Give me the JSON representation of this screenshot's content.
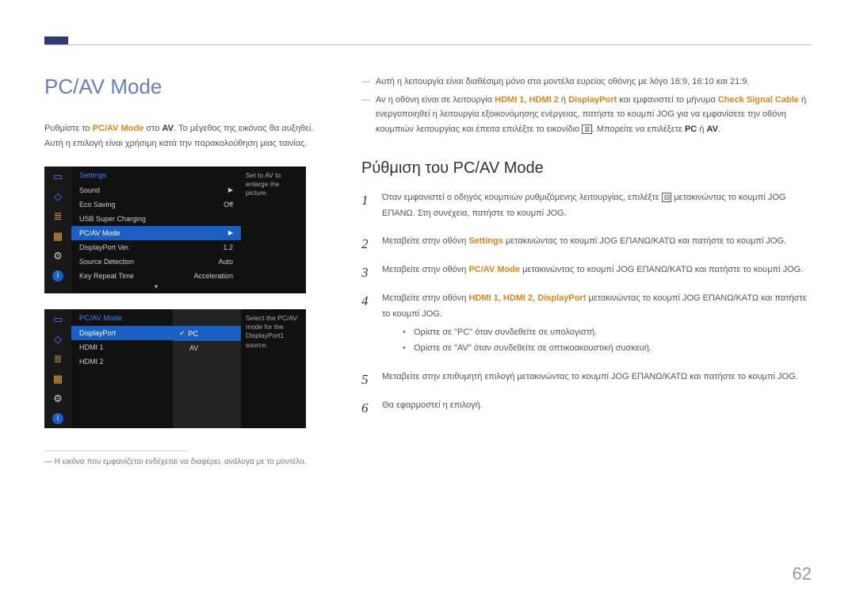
{
  "page_number": "62",
  "title": "PC/AV Mode",
  "intro_line1_pre": "Ρυθμίστε το ",
  "intro_line1_hl": "PC/AV Mode",
  "intro_line1_mid": " στο ",
  "intro_line1_hl2": "AV",
  "intro_line1_post": ". Το μέγεθος της εικόνας θα αυξηθεί.",
  "intro_line2": "Αυτή η επιλογή είναι χρήσιμη κατά την παρακολούθηση μιας ταινίας.",
  "osd1": {
    "header": "Settings",
    "hint": "Set to AV to enlarge the picture.",
    "rows": [
      {
        "label": "Sound",
        "value": "",
        "arrow": true
      },
      {
        "label": "Eco Saving",
        "value": "Off"
      },
      {
        "label": "USB Super Charging",
        "value": ""
      },
      {
        "label": "PC/AV Mode",
        "value": "",
        "arrow": true,
        "selected": true
      },
      {
        "label": "DisplayPort Ver.",
        "value": "1.2"
      },
      {
        "label": "Source Detection",
        "value": "Auto"
      },
      {
        "label": "Key Repeat Time",
        "value": "Acceleration"
      }
    ]
  },
  "osd2": {
    "header": "PC/AV Mode",
    "hint": "Select the PC/AV mode for the DisplayPort1 source.",
    "rows": [
      {
        "label": "DisplayPort",
        "selected": true
      },
      {
        "label": "HDMI 1"
      },
      {
        "label": "HDMI 2"
      }
    ],
    "options": [
      {
        "label": "PC",
        "selected": true,
        "checked": true
      },
      {
        "label": "AV"
      }
    ]
  },
  "footnote": "Η εικόνα που εμφανίζεται ενδέχεται να διαφέρει, ανάλογα με το μοντέλο.",
  "notes": {
    "n1": "Αυτή η λειτουργία είναι διαθέσιμη μόνο στα μοντέλα ευρείας οθόνης με λόγο 16:9, 16:10 και 21:9.",
    "n2_pre": "Αν η οθόνη είναι σε λειτουργία ",
    "n2_h1": "HDMI 1",
    "n2_sep1": ", ",
    "n2_h2": "HDMI 2",
    "n2_or": " ή ",
    "n2_dp": "DisplayPort",
    "n2_mid": " και εμφανιστεί το μήνυμα ",
    "n2_msg": "Check Signal Cable",
    "n2_post": " ή ενεργοποιηθεί η λειτουργία εξοικονόμησης ενέργειας, πατήστε το κουμπί JOG για να εμφανίσετε την οθόνη κουμπιών λειτουργίας και έπειτα επιλέξτε το εικονίδιο ",
    "n2_tail_pre": ". Μπορείτε να επιλέξετε ",
    "n2_pc": "PC",
    "n2_or2": " ή ",
    "n2_av": "AV",
    "n2_end": "."
  },
  "section_title": "Ρύθμιση του PC/AV Mode",
  "steps": {
    "s1a": "Όταν εμφανιστεί ο οδηγός κουμπιών ρυθμιζόμενης λειτουργίας, επιλέξτε ",
    "s1b": " μετακινώντας το κουμπί JOG ΕΠΑΝΩ. Στη συνέχεια, πατήστε το κουμπί JOG.",
    "s2a": "Μεταβείτε στην οθόνη ",
    "s2_hl": "Settings",
    "s2b": " μετακινώντας το κουμπί JOG ΕΠΑΝΩ/ΚΑΤΩ και πατήστε το κουμπί JOG.",
    "s3a": "Μεταβείτε στην οθόνη ",
    "s3_hl": "PC/AV Mode",
    "s3b": " μετακινώντας το κουμπί JOG ΕΠΑΝΩ/ΚΑΤΩ και πατήστε το κουμπί JOG.",
    "s4a": "Μεταβείτε στην οθόνη ",
    "s4_h1": "HDMI 1",
    "s4_sep": ", ",
    "s4_h2": "HDMI 2",
    "s4_sep2": ", ",
    "s4_dp": "DisplayPort",
    "s4b": " μετακινώντας το κουμπί JOG ΕΠΑΝΩ/ΚΑΤΩ και πατήστε το κουμπί JOG.",
    "b1": "Ορίστε σε \"PC\" όταν συνδεθείτε σε υπολογιστή.",
    "b2": "Ορίστε σε \"AV\" όταν συνδεθείτε σε οπτικοακουστική συσκευή.",
    "s5": "Μεταβείτε στην επιθυμητή επιλογή μετακινώντας το κουμπί JOG ΕΠΑΝΩ/ΚΑΤΩ και πατήστε το κουμπί JOG.",
    "s6": "Θα εφαρμοστεί η επιλογή."
  },
  "icon_glyph": "▥"
}
